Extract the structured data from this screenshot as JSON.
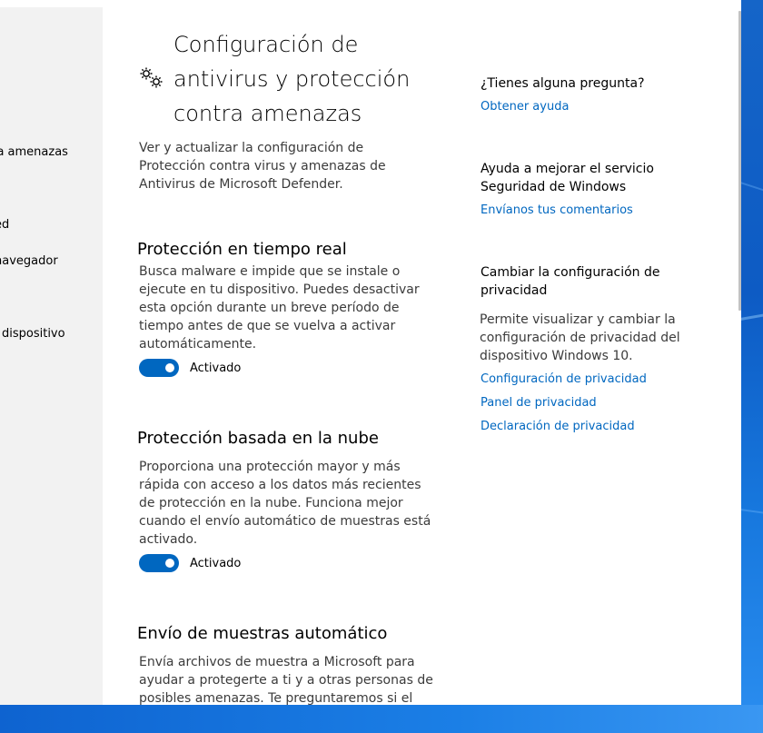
{
  "nav": {
    "items": [
      {
        "label": "tra amenazas"
      },
      {
        "label": "ed"
      },
      {
        "label": "navegador"
      },
      {
        "label": "dispositivo"
      }
    ]
  },
  "header": {
    "icon": "gears-icon",
    "title": "Configuración de antivirus y protección contra amenazas",
    "description": "Ver y actualizar la configuración de Protección contra virus y amenazas de Antivirus de Microsoft Defender."
  },
  "sections": [
    {
      "title": "Protección en tiempo real",
      "description": "Busca malware e impide que se instale o ejecute en tu dispositivo. Puedes desactivar esta opción durante un breve período de tiempo antes de que se vuelva a activar automáticamente.",
      "toggle_state": true,
      "toggle_label": "Activado"
    },
    {
      "title": "Protección basada en la nube",
      "description": "Proporciona una protección mayor y más rápida con acceso a los datos más recientes de protección en la nube. Funciona mejor cuando el envío automático de muestras está activado.",
      "toggle_state": true,
      "toggle_label": "Activado"
    },
    {
      "title": "Envío de muestras automático",
      "description": "Envía archivos de muestra a Microsoft para ayudar a protegerte a ti y a otras personas de posibles amenazas. Te preguntaremos si el"
    }
  ],
  "sidebar": {
    "question_heading": "¿Tienes alguna pregunta?",
    "help_link": "Obtener ayuda",
    "improve_heading": "Ayuda a mejorar el servicio Seguridad de Windows",
    "feedback_link": "Envíanos tus comentarios",
    "privacy_heading": "Cambiar la configuración de privacidad",
    "privacy_text": "Permite visualizar y cambiar la configuración de privacidad del dispositivo Windows 10.",
    "privacy_links": [
      "Configuración de privacidad",
      "Panel de privacidad",
      "Declaración de privacidad"
    ]
  },
  "colors": {
    "accent": "#0067c0",
    "nav_background": "#f2f2f2",
    "desktop": "#1565c8"
  }
}
